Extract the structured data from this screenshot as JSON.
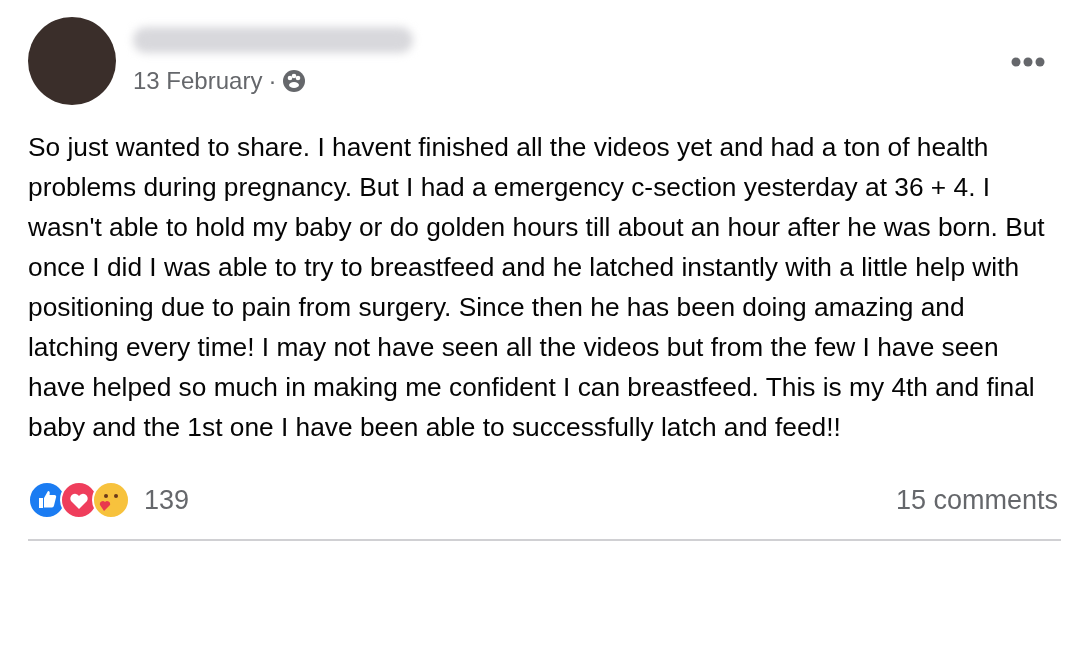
{
  "post": {
    "date": "13 February",
    "separator": "·",
    "body": "So just wanted to share. I havent finished all the videos yet and had a ton of health problems during pregnancy. But I had a emergency c-section yesterday at 36 + 4. I wasn't able to hold my baby or do golden hours till about an hour after he was born. But once I did I was able to try to breastfeed and he latched instantly with a little help with positioning due to pain from surgery. Since then he has been doing amazing and latching every time! I may not have seen all the videos but from the few I have seen have helped so much in making me confident I can breastfeed. This is my 4th and final baby and the 1st one I have been able to successfully latch and feed!!"
  },
  "reactions": {
    "count": "139",
    "comments": "15 comments"
  }
}
